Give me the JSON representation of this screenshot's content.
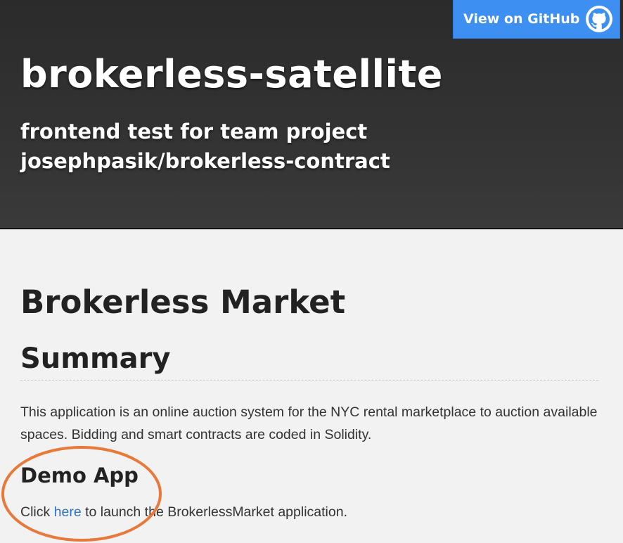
{
  "header": {
    "github_button_label": "View on GitHub",
    "project_name": "brokerless-satellite",
    "project_tagline": "frontend test for team project josephpasik/brokerless-contract"
  },
  "main": {
    "title": "Brokerless Market",
    "summary_heading": "Summary",
    "summary_text": "This application is an online auction system for the NYC rental marketplace to auction available spaces. Bidding and smart contracts are coded in Solidity.",
    "demo_heading": "Demo App",
    "demo_text_before": "Click ",
    "demo_link_label": "here",
    "demo_text_after": " to launch the BrokerlessMarket application."
  },
  "icons": {
    "github": "github-octocat-icon"
  },
  "colors": {
    "header_bg": "#333333",
    "github_button": "#3d8ff2",
    "link": "#2f74c0",
    "annotation_circle": "#e9793a"
  }
}
